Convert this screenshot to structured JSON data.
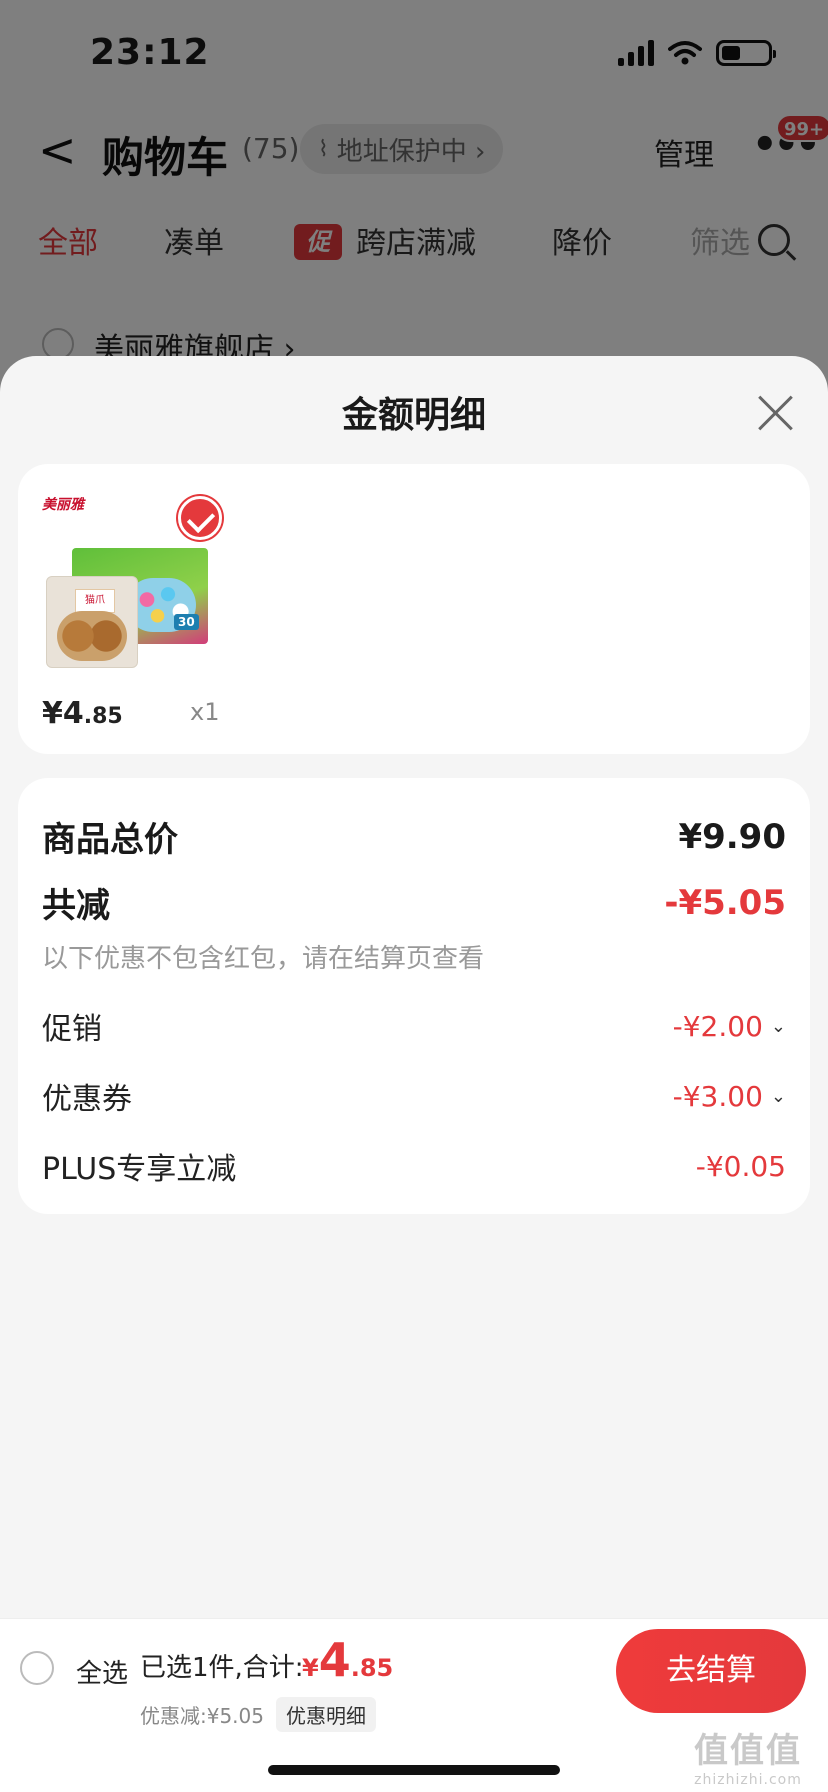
{
  "status_bar": {
    "time": "23:12"
  },
  "header": {
    "back": "<",
    "title": "购物车",
    "count": "(75)",
    "address_protect": "地址保护中 ›",
    "manage": "管理",
    "more": "•••",
    "badge": "99+"
  },
  "tabs": {
    "all": "全部",
    "combine": "凑单",
    "promo_tag": "促",
    "cross_store": "跨店满减",
    "price_drop": "降价",
    "filter": "筛选"
  },
  "store": {
    "name": "美丽雅旗舰店 ›"
  },
  "sheet": {
    "title": "金额明细",
    "product": {
      "brand": "美丽雅",
      "bag_label": "猫爪",
      "box_label": "30",
      "price_int": "¥4",
      "price_cents": ".85",
      "qty": "x1"
    },
    "total_label": "商品总价",
    "total_value": "¥9.90",
    "discount_label": "共减",
    "discount_value": "-¥5.05",
    "note": "以下优惠不包含红包，请在结算页查看",
    "items": [
      {
        "label": "促销",
        "value": "-¥2.00",
        "chevron": "⌄"
      },
      {
        "label": "优惠券",
        "value": "-¥3.00",
        "chevron": "⌄"
      },
      {
        "label": "PLUS专享立减",
        "value": "-¥0.05"
      }
    ]
  },
  "bottom": {
    "select_all": "全选",
    "selected": "已选1件,合计:",
    "yen": "¥",
    "int": "4",
    "cents": ".85",
    "discount": "优惠减:¥5.05",
    "detail_chip": "优惠明细",
    "checkout": "去结算"
  },
  "watermark": {
    "glyphs": "值值值",
    "url": "zhizhizhi.com"
  }
}
